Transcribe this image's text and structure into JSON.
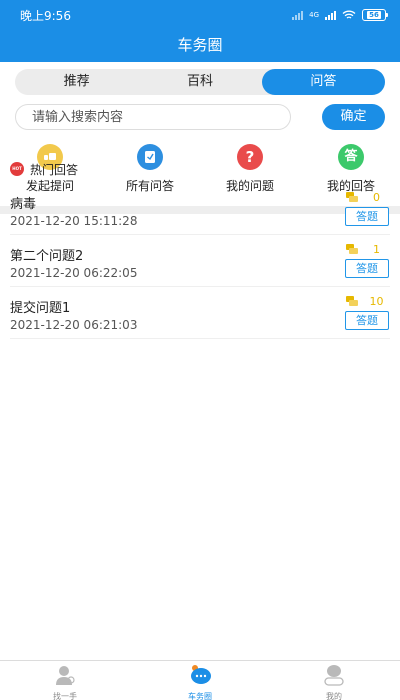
{
  "status_bar": {
    "time": "晚上9:56",
    "network": "4G",
    "battery": "56"
  },
  "header": {
    "title": "车务圈"
  },
  "tabs": [
    {
      "label": "推荐",
      "active": false
    },
    {
      "label": "百科",
      "active": false
    },
    {
      "label": "问答",
      "active": true
    }
  ],
  "search": {
    "placeholder": "请输入搜索内容",
    "value": "",
    "button": "确定"
  },
  "quick_actions": [
    {
      "label": "发起提问",
      "icon": "ask-icon",
      "color": "#f2c94c"
    },
    {
      "label": "所有问答",
      "icon": "notebook-icon",
      "color": "#2d8fe0"
    },
    {
      "label": "我的问题",
      "icon": "question-mark-icon",
      "color": "#e94b4b"
    },
    {
      "label": "我的回答",
      "icon": "answer-icon",
      "color": "#3cc96b"
    }
  ],
  "hot": {
    "badge": "HOT",
    "title": "热门回答"
  },
  "questions": [
    {
      "title": "病毒",
      "time": "2021-12-20 15:11:28",
      "coins": "0",
      "button": "答题"
    },
    {
      "title": "第二个问题2",
      "time": "2021-12-20 06:22:05",
      "coins": "1",
      "button": "答题"
    },
    {
      "title": "提交问题1",
      "time": "2021-12-20 06:21:03",
      "coins": "10",
      "button": "答题"
    }
  ],
  "bottom_nav": [
    {
      "label": "找一手",
      "icon": "person-icon",
      "active": false
    },
    {
      "label": "车务圈",
      "icon": "chat-bubble-icon",
      "active": true
    },
    {
      "label": "我的",
      "icon": "profile-icon",
      "active": false
    }
  ],
  "colors": {
    "primary": "#1b8ee6",
    "coin": "#e6b800",
    "hot": "#e23c3c"
  }
}
